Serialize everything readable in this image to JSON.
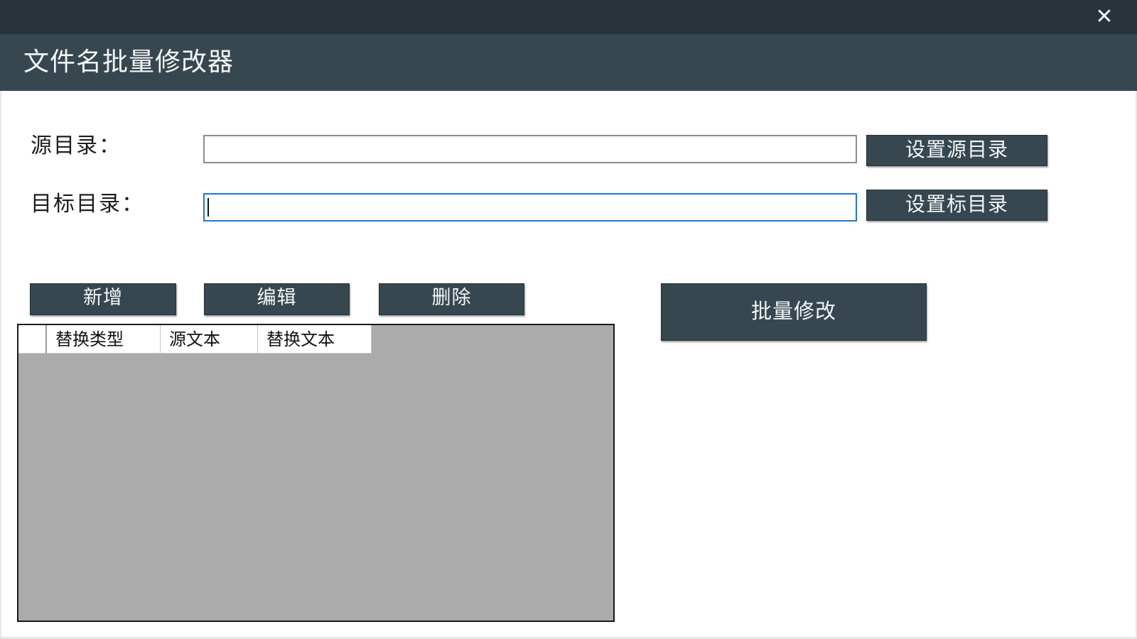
{
  "window": {
    "title": "文件名批量修改器",
    "close_icon": "close-icon",
    "colors": {
      "top_strip": "#29333b",
      "header": "#37474f",
      "button": "#37474f",
      "button_text": "#f4f6f7",
      "grid_background": "#ababab",
      "focus_border": "#1f78d1"
    }
  },
  "form": {
    "source_label": "源目录：",
    "target_label": "目标目录：",
    "source_value": "",
    "target_value": "",
    "set_source_button": "设置源目录",
    "set_target_button": "设置标目录"
  },
  "actions": {
    "add_button": "新增",
    "edit_button": "编辑",
    "delete_button": "删除",
    "batch_button": "批量修改"
  },
  "grid": {
    "columns": [
      "替换类型",
      "源文本",
      "替换文本"
    ],
    "rows": []
  }
}
